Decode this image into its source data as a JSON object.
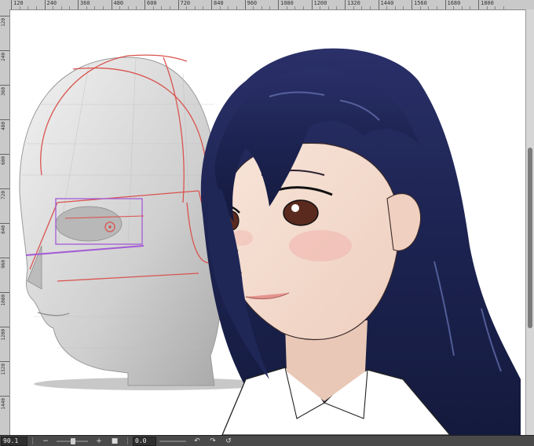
{
  "ruler_top": {
    "labels": [
      "120",
      "240",
      "360",
      "480",
      "600",
      "720",
      "840",
      "960",
      "1080",
      "1200",
      "1320",
      "1440",
      "1560",
      "1680",
      "1800"
    ]
  },
  "ruler_left": {
    "labels": [
      "120",
      "240",
      "360",
      "480",
      "600",
      "720",
      "840",
      "960",
      "1080",
      "1200",
      "1320",
      "1440"
    ]
  },
  "status_bar": {
    "zoom_value": "90.1",
    "zoom_out_label": "−",
    "zoom_in_label": "+",
    "fit_label": "■",
    "angle_value": "0.0",
    "rotate_left_label": "↶",
    "rotate_right_label": "↷",
    "reset_label": "↺"
  },
  "colors": {
    "hair": "#1c2350",
    "skin": "#f4ddd0",
    "head_model": "#d9d9d9",
    "guide_lines": "#d9534f",
    "eye_guide": "#a35ad6"
  }
}
